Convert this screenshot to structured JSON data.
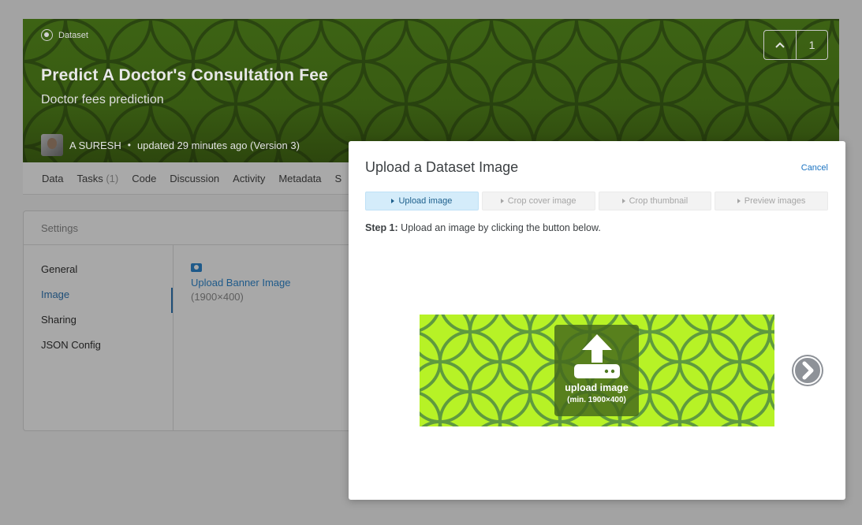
{
  "page": {
    "breadcrumb": "Dataset",
    "title": "Predict A Doctor's Consultation Fee",
    "subtitle": "Doctor fees prediction",
    "author": "A SURESH",
    "updated": "updated 29 minutes ago (Version 3)",
    "vote_count": "1",
    "tabs": [
      {
        "label": "Data"
      },
      {
        "label": "Tasks",
        "count": "(1)"
      },
      {
        "label": "Code"
      },
      {
        "label": "Discussion"
      },
      {
        "label": "Activity"
      },
      {
        "label": "Metadata"
      },
      {
        "label": "S"
      }
    ],
    "settings": {
      "heading": "Settings",
      "nav": [
        "General",
        "Image",
        "Sharing",
        "JSON Config"
      ],
      "active_nav": "Image",
      "upload_banner_label": "Upload Banner Image",
      "upload_banner_size": "(1900×400)"
    }
  },
  "modal": {
    "title": "Upload a Dataset Image",
    "cancel_label": "Cancel",
    "steps": [
      "Upload image",
      "Crop cover image",
      "Crop thumbnail",
      "Preview images"
    ],
    "active_step": 0,
    "step_prefix": "Step 1:",
    "step_text": "Upload an image by clicking the button below.",
    "upload_label": "upload image",
    "upload_min": "(min. 1900×400)"
  },
  "colors": {
    "banner_bg": "#3d6314",
    "preview_bg": "#b7f226",
    "link": "#1a73c2",
    "active_step_bg": "#d4ecfa"
  },
  "icons": [
    "dataset-icon",
    "chevron-up-icon",
    "camera-icon",
    "upload-icon",
    "chevron-right-icon"
  ]
}
